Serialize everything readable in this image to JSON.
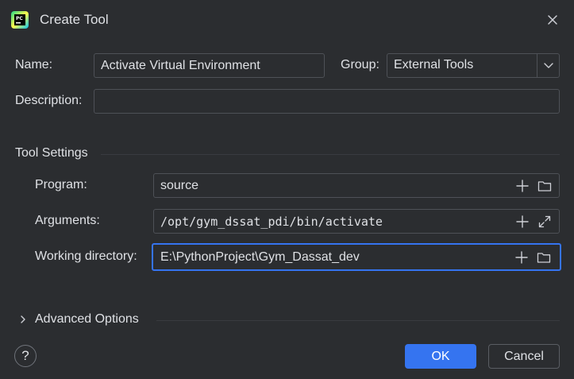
{
  "dialog": {
    "title": "Create Tool",
    "app_icon_text": "PC"
  },
  "form": {
    "name_label": "Name:",
    "name_value": "Activate Virtual Environment",
    "group_label": "Group:",
    "group_value": "External Tools",
    "description_label": "Description:",
    "description_value": ""
  },
  "tool_settings": {
    "section_title": "Tool Settings",
    "program_label": "Program:",
    "program_value": "source",
    "arguments_label": "Arguments:",
    "arguments_value": "/opt/gym_dssat_pdi/bin/activate",
    "working_dir_label": "Working directory:",
    "working_dir_value": "E:\\PythonProject\\Gym_Dassat_dev"
  },
  "advanced": {
    "label": "Advanced Options",
    "expanded": false
  },
  "footer": {
    "help_label": "?",
    "ok_label": "OK",
    "cancel_label": "Cancel"
  },
  "colors": {
    "background": "#2b2d30",
    "border": "#4e5157",
    "accent": "#3574f0",
    "text": "#dfe1e5",
    "icon": "#ced0d6"
  }
}
